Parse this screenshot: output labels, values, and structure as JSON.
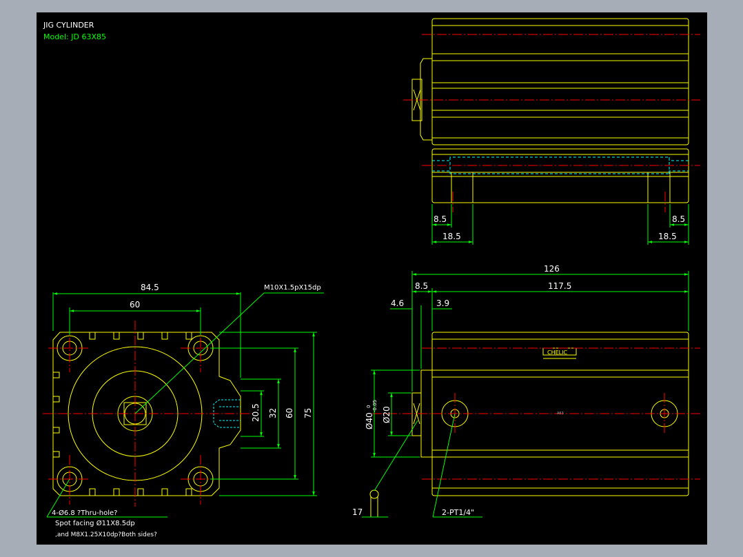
{
  "header": {
    "title": "JIG CYLINDER",
    "model": "Model: JD 63X85"
  },
  "colors": {
    "frame": "#a6adb6",
    "background": "#000000",
    "outline": "#ffff00",
    "dimension": "#00ff00",
    "centerline": "#ff0000",
    "hidden": "#00ffff",
    "text": "#ffffff"
  },
  "front_view": {
    "dims": {
      "overall_width": "84.5",
      "bolt_pitch_h": "60",
      "port_spacing": "20.5",
      "pitch_32": "32",
      "bolt_pitch_v": "60",
      "overall_height": "75"
    },
    "callouts": {
      "thread": "M10X1.5pX15dp",
      "hole_1": "4-Ø6.8 ?Thru-hole?",
      "hole_2": "Spot facing Ø11X8.5dp",
      "hole_3": ",and M8X1.25X10dp?Both sides?"
    }
  },
  "top_view": {
    "dims": {
      "left_small": "8.5",
      "left_large": "18.5",
      "right_small": "8.5",
      "right_large": "18.5"
    }
  },
  "side_view": {
    "dims": {
      "total_length": "126",
      "cap_length": "8.5",
      "body_length": "117.5",
      "rod_offset": "4.6",
      "boss_length": "3.9",
      "rod_dia": "Ø40",
      "rod_tol_upper": "0",
      "rod_tol_lower": "-0.05",
      "pin_dia": "Ø20",
      "flat": "17",
      "ports": "2-PT1/4\"",
      "brand": "CHELIC",
      "note": "A63"
    }
  }
}
